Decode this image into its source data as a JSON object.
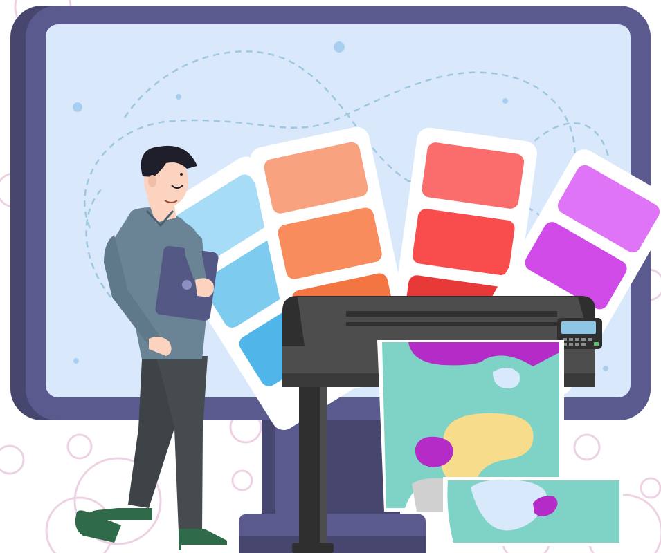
{
  "illustration": {
    "subject": "designer-with-large-format-printer",
    "palette": {
      "monitor_frame": "#5b5a8e",
      "monitor_frame_dark": "#47466f",
      "screen": "#d9e9fb",
      "dash_line": "#9fc7e0",
      "ring": "#eed2e4",
      "printer_body": "#4d4d4d",
      "printer_dark": "#2f2f2f",
      "printer_panel_screen": "#8ec7e6",
      "print_paper": "#7fd3c6",
      "print_purple": "#b42bc8",
      "print_yellow": "#f7dc8c",
      "print_light_blue": "#d7e9fb",
      "shirt": "#6a8496",
      "pants": "#454b4e",
      "hair": "#1f1f2b",
      "skin": "#fbd3bf",
      "tablet": "#535884"
    },
    "swatch_fan": [
      {
        "name": "blue-column",
        "colors": [
          "#a6dcf6",
          "#7ecbf0",
          "#50b6ea"
        ]
      },
      {
        "name": "orange-column",
        "colors": [
          "#f9a27f",
          "#f88c5c",
          "#f37541"
        ]
      },
      {
        "name": "red-column",
        "colors": [
          "#fb6c6c",
          "#f94d4d",
          "#e83939"
        ]
      },
      {
        "name": "purple-column",
        "colors": [
          "#df74f6",
          "#d04ae8"
        ]
      }
    ],
    "icons": [
      "monitor-icon",
      "printer-icon",
      "tablet-icon",
      "color-swatch-icon"
    ]
  }
}
